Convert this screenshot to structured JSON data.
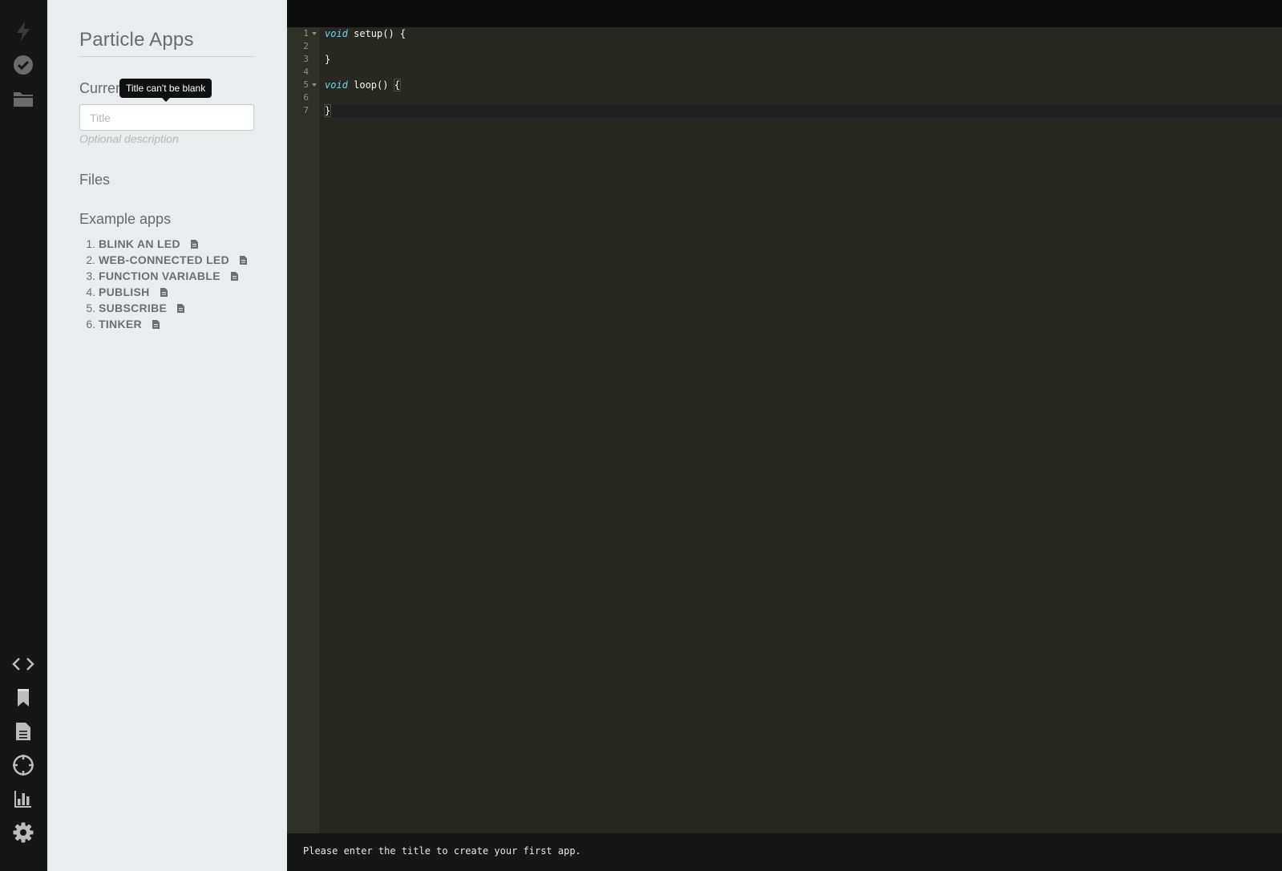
{
  "sidebar": {
    "title": "Particle Apps",
    "current_app_label": "Curren",
    "tooltip": "Title can't be blank",
    "title_input_placeholder": "Title",
    "description_placeholder": "Optional description",
    "files_heading": "Files",
    "examples_heading": "Example apps",
    "examples": [
      {
        "num": "1.",
        "label": "BLINK AN LED"
      },
      {
        "num": "2.",
        "label": "WEB-CONNECTED LED"
      },
      {
        "num": "3.",
        "label": "FUNCTION VARIABLE"
      },
      {
        "num": "4.",
        "label": "PUBLISH"
      },
      {
        "num": "5.",
        "label": "SUBSCRIBE"
      },
      {
        "num": "6.",
        "label": "TINKER"
      }
    ]
  },
  "rail": {
    "top_icons": [
      "flash-icon",
      "verify-icon",
      "folder-icon"
    ],
    "bottom_icons": [
      "code-icon",
      "bookmark-icon",
      "document-icon",
      "crosshair-icon",
      "chart-icon",
      "gear-icon"
    ]
  },
  "editor": {
    "line_numbers": [
      "1",
      "2",
      "3",
      "4",
      "5",
      "6",
      "7"
    ],
    "lines": [
      {
        "keyword": "void",
        "rest": " setup() {"
      },
      {
        "keyword": "",
        "rest": ""
      },
      {
        "keyword": "",
        "rest": "}"
      },
      {
        "keyword": "",
        "rest": ""
      },
      {
        "keyword": "void",
        "rest": " loop() "
      },
      {
        "keyword": "",
        "rest": ""
      },
      {
        "keyword": "",
        "rest": "}"
      }
    ],
    "loop_brace": "{",
    "colors": {
      "background": "#272822",
      "keyword": "#66d9ef",
      "text": "#f8f8f2"
    }
  },
  "status": {
    "message": "Please enter the title to create your first app."
  }
}
